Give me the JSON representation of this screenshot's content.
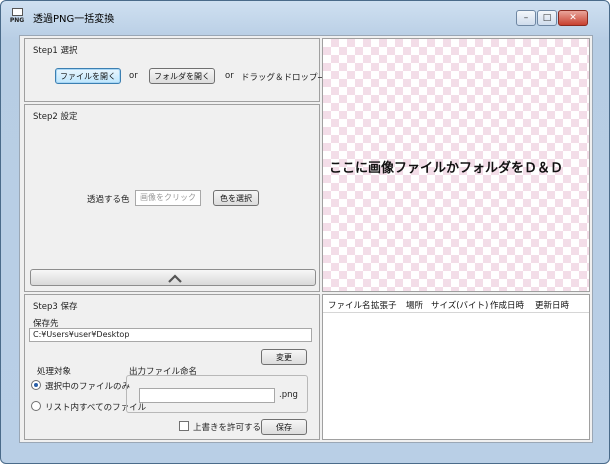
{
  "window": {
    "title": "透過PNG一括変換",
    "icon_label": "PNG",
    "controls": {
      "minimize": "–",
      "maximize": "□",
      "close": "✕"
    }
  },
  "step1": {
    "title": "Step1  選択",
    "open_file_button": "ファイルを開く",
    "or1": "or",
    "open_folder_button": "フォルダを開く",
    "or2": "or",
    "drag_drop_hint": "ドラッグ＆ドロップ→"
  },
  "step2": {
    "title": "Step2  設定",
    "transparent_color_label": "透過する色",
    "color_input_placeholder": "画像をクリック",
    "select_color_button": "色を選択",
    "collapse_icon": "chevron-up-icon"
  },
  "step3": {
    "title": "Step3  保存",
    "save_dest_label": "保存先",
    "save_path": "C:¥Users¥user¥Desktop",
    "change_button": "変更",
    "target_label": "処理対象",
    "radio_selected_label": "選択中のファイルのみ",
    "radio_all_label": "リスト内すべてのファイル",
    "naming_label": "出力ファイル命名",
    "filename_value": "",
    "extension_label": ".png",
    "overwrite_label": "上書きを許可する",
    "save_button": "保存"
  },
  "preview": {
    "drop_text": "ここに画像ファイルかフォルダをＤ＆Ｄ"
  },
  "file_list": {
    "columns": [
      "ファイル名",
      "拡張子",
      "場所",
      "サイズ(バイト)",
      "作成日時",
      "更新日時"
    ]
  }
}
